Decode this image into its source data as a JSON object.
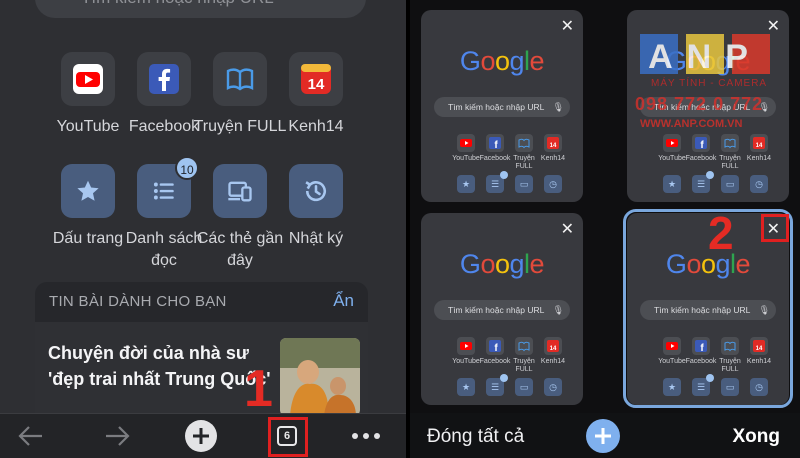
{
  "left": {
    "search_placeholder": "Tìm kiếm hoặc nhập URL",
    "shortcuts": [
      {
        "label": "YouTube",
        "icon": "youtube-icon"
      },
      {
        "label": "Facebook",
        "icon": "facebook-icon"
      },
      {
        "label": "Truyện FULL",
        "icon": "book-icon"
      },
      {
        "label": "Kenh14",
        "icon": "kenh14-icon"
      }
    ],
    "actions": [
      {
        "label": "Dấu trang",
        "icon": "star-icon"
      },
      {
        "label": "Danh sách đọc",
        "icon": "reading-list-icon",
        "badge": "10"
      },
      {
        "label": "Các thẻ gần đây",
        "icon": "devices-icon"
      },
      {
        "label": "Nhật ký",
        "icon": "history-icon"
      }
    ],
    "news_header": "TIN BÀI DÀNH CHO BẠN",
    "news_hide": "Ẩn",
    "news_title": "Chuyện đời của nhà sư 'đẹp trai nhất Trung Quốc'",
    "tab_count": "6",
    "annotation": "1"
  },
  "right": {
    "card": {
      "logo": "Google",
      "search_placeholder": "Tìm kiếm hoặc nhập URL",
      "shortcuts": [
        "YouTube",
        "Facebook",
        "Truyện FULL",
        "Kenh14"
      ]
    },
    "close_all": "Đóng tất cả",
    "done": "Xong",
    "annotation": "2",
    "watermark": {
      "brand": "ANP",
      "tagline": "MÁY TÍNH - CAMERA",
      "phone": "098 772 0 772",
      "url": "WWW.ANP.COM.VN"
    }
  },
  "colors": {
    "accent": "#7fb0ee",
    "annotation_red": "#e42b24",
    "youtube_red": "#ff0000",
    "facebook_blue": "#1877f2"
  }
}
